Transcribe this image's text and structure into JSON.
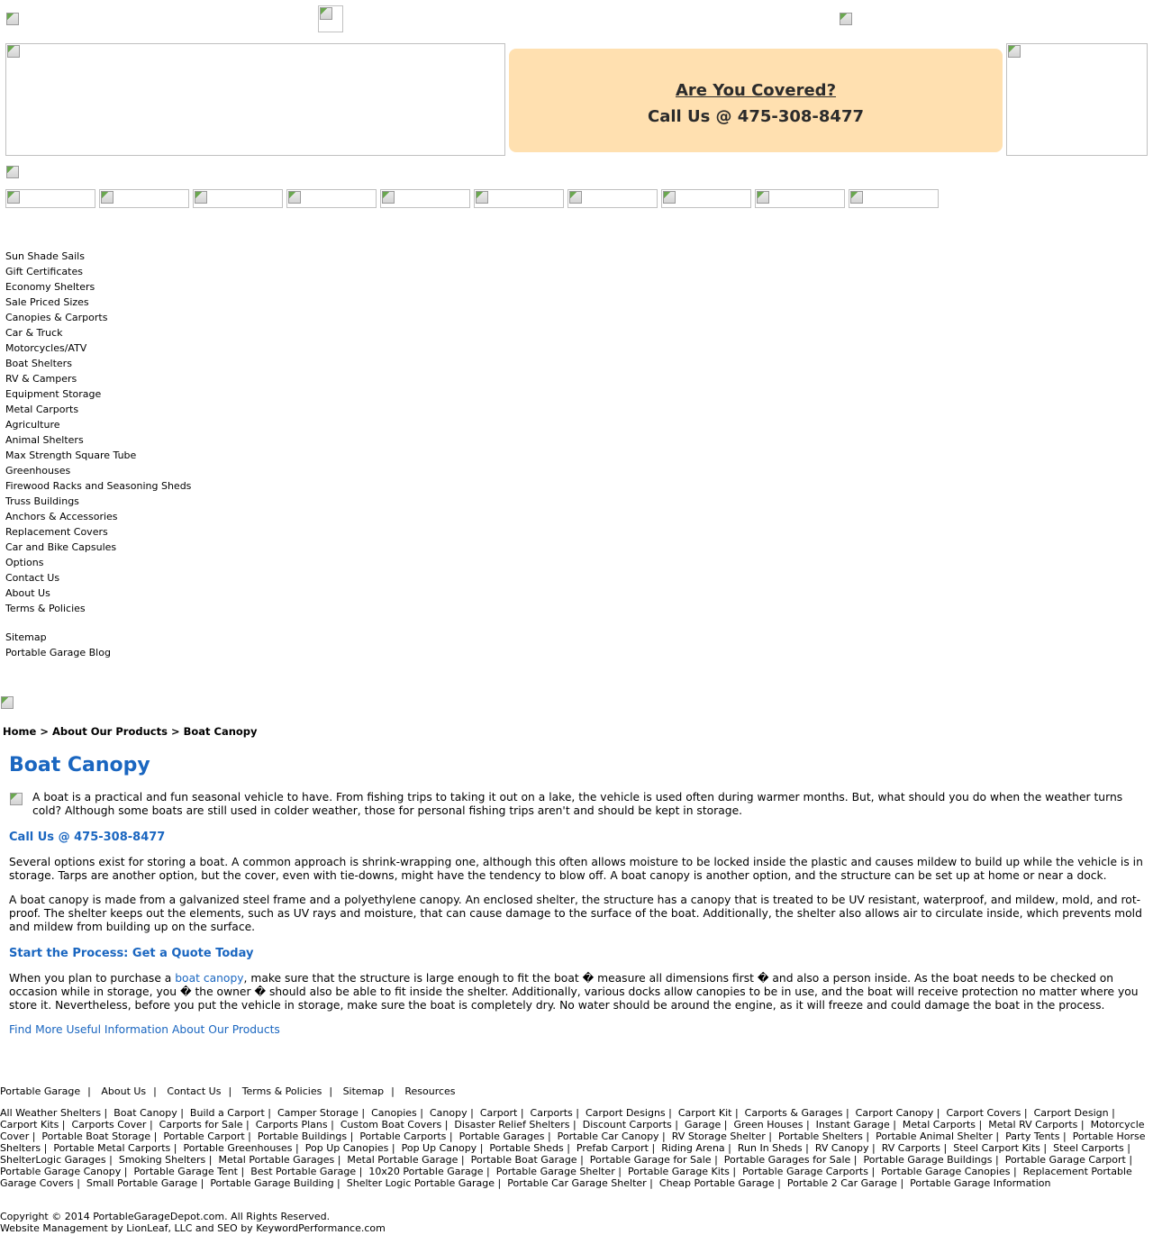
{
  "header": {
    "callout_question": "Are You Covered?",
    "callout_phone": "Call Us @ 475-308-8477"
  },
  "sidebar": {
    "items": [
      "Sun Shade Sails",
      "Gift Certificates",
      "Economy Shelters",
      "Sale Priced Sizes",
      "Canopies & Carports",
      "Car & Truck",
      "Motorcycles/ATV",
      "Boat Shelters",
      "RV & Campers",
      "Equipment Storage",
      "Metal Carports",
      "Agriculture",
      "Animal Shelters",
      "Max Strength Square Tube",
      "Greenhouses",
      "Firewood Racks and Seasoning Sheds",
      "Truss Buildings",
      "Anchors & Accessories",
      "Replacement Covers",
      "Car and Bike Capsules",
      "Options",
      "Contact Us",
      "About Us",
      "Terms & Policies"
    ],
    "extra": [
      "Sitemap",
      "Portable Garage Blog"
    ]
  },
  "breadcrumb": {
    "home": "Home",
    "sep": ">",
    "section": "About Our Products",
    "current": "Boat Canopy"
  },
  "main": {
    "title": "Boat Canopy",
    "intro": "A boat is a practical and fun seasonal vehicle to have. From fishing trips to taking it out on a lake, the vehicle is used often during warmer months. But, what should you do when the weather turns cold? Although some boats are still used in colder weather, those for personal fishing trips aren't and should be kept in storage.",
    "call_heading": "Call Us @ 475-308-8477",
    "para1": "Several options exist for storing a boat. A common approach is shrink-wrapping one, although this often allows moisture to be locked inside the plastic and causes mildew to build up while the vehicle is in storage. Tarps are another option, but the cover, even with tie-downs, might have the tendency to blow off. A boat canopy is another option, and the structure can be set up at home or near a dock.",
    "para2": "A boat canopy is made from a galvanized steel frame and a polyethylene canopy. An enclosed shelter, the structure has a canopy that is treated to be UV resistant, waterproof, and mildew, mold, and rot-proof. The shelter keeps out the elements, such as UV rays and moisture, that can cause damage to the surface of the boat. Additionally, the shelter also allows air to circulate inside, which prevents mold and mildew from building up on the surface.",
    "quote_heading": "Start the Process: Get a Quote Today",
    "para3_before": "When you plan to purchase a ",
    "para3_link": "boat canopy",
    "para3_after": ", make sure that the structure is large enough to fit the boat � measure all dimensions first � and also a person inside. As the boat needs to be checked on occasion while in storage, you � the owner � should also be able to fit inside the shelter. Additionally, various docks allow canopies to be in use, and the boat will receive protection no matter where you store it. Nevertheless, before you put the vehicle in storage, make sure the boat is completely dry. No water should be around the engine, as it will freeze and could damage the boat in the process.",
    "more_link": "Find More Useful Information About Our Products"
  },
  "footer": {
    "links": [
      "Portable Garage",
      "About Us",
      "Contact Us",
      "Terms & Policies",
      "Sitemap",
      "Resources"
    ],
    "keywords": [
      "All Weather Shelters",
      "Boat Canopy",
      "Build a Carport",
      "Camper Storage",
      "Canopies",
      "Canopy",
      "Carport",
      "Carports",
      "Carport Designs",
      "Carport Kit",
      "Carports & Garages",
      "Carport Canopy",
      "Carport Covers",
      "Carport Design",
      "Carport Kits",
      "Carports Cover",
      "Carports for Sale",
      "Carports Plans",
      "Custom Boat Covers",
      "Disaster Relief Shelters",
      "Discount Carports",
      "Garage",
      "Green Houses",
      "Instant Garage",
      "Metal Carports",
      "Metal RV Carports",
      "Motorcycle Cover",
      "Portable Boat Storage",
      "Portable Carport",
      "Portable Buildings",
      "Portable Carports",
      "Portable Garages",
      "Portable Car Canopy",
      "RV Storage Shelter",
      "Portable Shelters",
      "Portable Animal Shelter",
      "Party Tents",
      "Portable Horse Shelters",
      "Portable Metal Carports",
      "Portable Greenhouses",
      "Pop Up Canopies",
      "Pop Up Canopy",
      "Portable Sheds",
      "Prefab Carport",
      "Riding Arena",
      "Run In Sheds",
      "RV Canopy",
      "RV Carports",
      "Steel Carport Kits",
      "Steel Carports",
      "ShelterLogic Garages",
      "Smoking Shelters",
      "Metal Portable Garages",
      "Metal Portable Garage",
      "Portable Boat Garage",
      "Portable Garage for Sale",
      "Portable Garages for Sale",
      "Portable Garage Buildings",
      "Portable Garage Carport",
      "Portable Garage Canopy",
      "Portable Garage Tent",
      "Best Portable Garage",
      "10x20 Portable Garage",
      "Portable Garage Shelter",
      "Portable Garage Kits",
      "Portable Garage Carports",
      "Portable Garage Canopies",
      "Replacement Portable Garage Covers",
      "Small Portable Garage",
      "Portable Garage Building",
      "Shelter Logic Portable Garage",
      "Portable Car Garage Shelter",
      "Cheap Portable Garage",
      "Portable 2 Car Garage",
      "Portable Garage Information"
    ],
    "copyright": "Copyright © 2014 PortableGarageDepot.com. All Rights Reserved.",
    "credits": "Website Management by LionLeaf, LLC and SEO by KeywordPerformance.com"
  }
}
